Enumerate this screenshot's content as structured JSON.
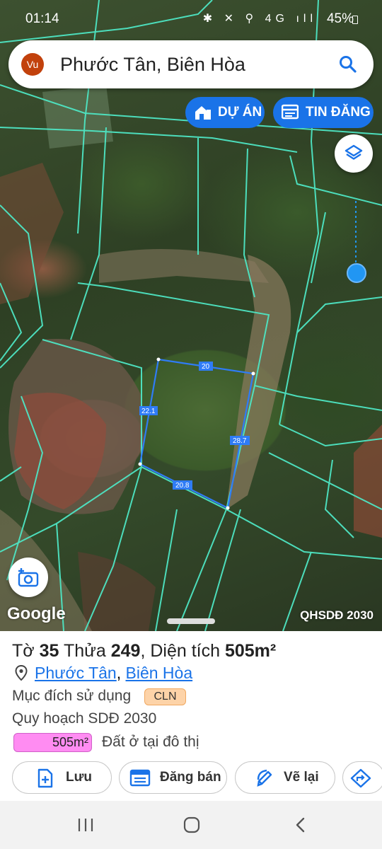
{
  "status_bar": {
    "time": "01:14",
    "icons": "✱ ✕ ⚲ 4G ıll",
    "battery": "45%"
  },
  "search": {
    "avatar": "Vu",
    "query": "Phước Tân, Biên Hòa"
  },
  "chips": {
    "projects": "DỰ ÁN",
    "listings": "TIN ĐĂNG"
  },
  "map": {
    "edges": {
      "top": "20",
      "left": "22.1",
      "right": "28.7",
      "bottom": "20.8"
    },
    "google": "Google",
    "plan_label": "QHSDĐ 2030",
    "parcel_line_color": "#4ee6c4",
    "selection_color": "#2f7cf6"
  },
  "parcel": {
    "sheet_label": "Tờ",
    "sheet_no": "35",
    "plot_label": "Thửa",
    "plot_no": "249",
    "area_label": "Diện tích",
    "area": "505m²",
    "ward": "Phước Tân",
    "separator": ",",
    "city": "Biên Hòa",
    "usage_label": "Mục đích sử dụng",
    "usage_code": "CLN",
    "plan_label": "Quy hoạch SDĐ 2030",
    "plan_area": "505m²",
    "plan_use": "Đất ở tại đô thị"
  },
  "actions": {
    "save": "Lưu",
    "sell": "Đăng bán",
    "redraw": "Vẽ lại"
  },
  "icons": [
    "search-icon",
    "home-icon",
    "listings-icon",
    "layers-icon",
    "add-photo-icon",
    "pin-icon",
    "add-file-icon",
    "calendar-icon",
    "edit-icon",
    "directions-icon",
    "recents-icon",
    "home-nav-icon",
    "back-icon"
  ]
}
